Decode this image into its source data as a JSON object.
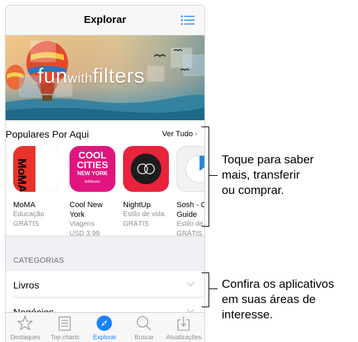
{
  "navbar": {
    "title": "Explorar",
    "menu_icon": "list-icon"
  },
  "banner": {
    "text_main": "fun",
    "text_with": "with",
    "text_filters": "filters"
  },
  "popular": {
    "title": "Populares Por Aqui",
    "see_all": "Ver Tudo",
    "apps": [
      {
        "name": "MoMA",
        "name2": "",
        "category": "Educação",
        "price": "GRÁTIS",
        "icon_text": "MoMA"
      },
      {
        "name": "Cool New",
        "name2": "York",
        "category": "Viagens",
        "price": "USD 3.99",
        "icon_text": "COOL",
        "icon_text2": "CITIES",
        "icon_text3": "NEW YORK",
        "icon_text4": "teNeues"
      },
      {
        "name": "NightUp",
        "name2": "",
        "category": "Estilo de vida",
        "price": "GRÁTIS"
      },
      {
        "name": "Sosh - C",
        "name2": "Guide",
        "category": "Estilo de",
        "price": "GRÁTIS"
      }
    ]
  },
  "categories": {
    "title": "CATEGORIAS",
    "items": [
      {
        "label": "Livros"
      },
      {
        "label": "Negócios"
      }
    ]
  },
  "tabbar": {
    "tabs": [
      {
        "label": "Destaques",
        "icon": "star-icon"
      },
      {
        "label": "Top charts",
        "icon": "top-charts-icon"
      },
      {
        "label": "Explorar",
        "icon": "compass-icon",
        "active": true
      },
      {
        "label": "Buscar",
        "icon": "search-icon"
      },
      {
        "label": "Atualizações",
        "icon": "updates-icon"
      }
    ]
  },
  "callouts": {
    "first": [
      "Toque para saber",
      "mais, transferir",
      "ou comprar."
    ],
    "second": [
      "Confira os aplicativos",
      "em suas áreas de",
      "interesse."
    ]
  },
  "colors": {
    "accent": "#1a82fb",
    "moma_red": "#e8322a",
    "cool_pink": "#e0157f",
    "nightup_red": "#e8233c"
  }
}
